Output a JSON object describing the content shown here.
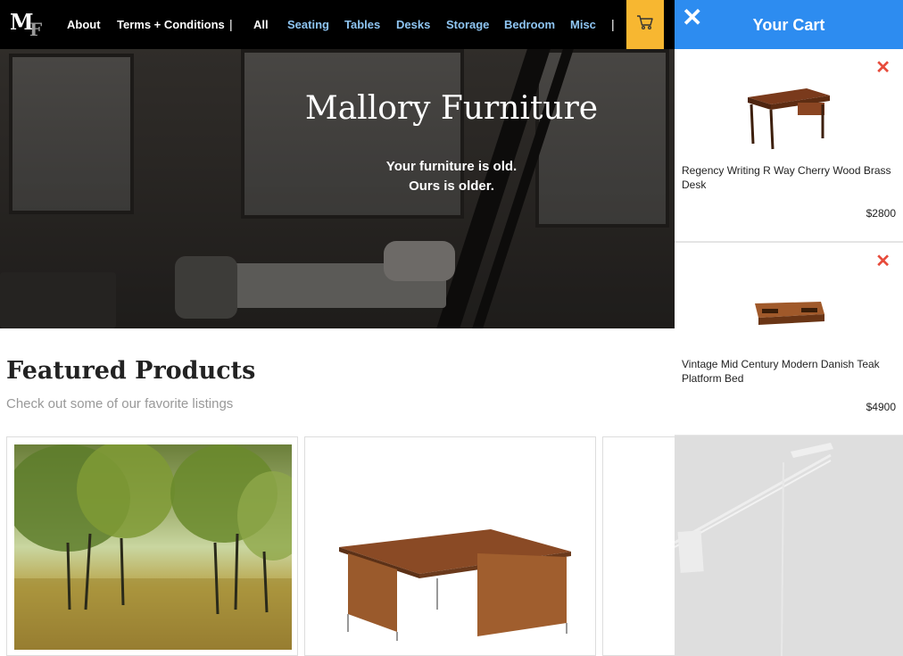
{
  "nav": {
    "about": "About",
    "terms": "Terms + Conditions",
    "separator": "|",
    "categories": [
      "All",
      "Seating",
      "Tables",
      "Desks",
      "Storage",
      "Bedroom",
      "Misc"
    ]
  },
  "hero": {
    "title": "Mallory Furniture",
    "subtitle_line1": "Your furniture is old.",
    "subtitle_line2": "Ours is older."
  },
  "featured": {
    "title": "Featured Products",
    "subtitle": "Check out some of our favorite listings"
  },
  "cart": {
    "title": "Your Cart",
    "close": "✕",
    "remove": "✕",
    "items": [
      {
        "name": "Regency Writing R Way Cherry Wood Brass Desk",
        "price": "$2800"
      },
      {
        "name": "Vintage Mid Century Modern Danish Teak Platform Bed",
        "price": "$4900"
      }
    ]
  },
  "colors": {
    "nav_bg": "#000000",
    "category_link": "#8ec5f2",
    "cart_button": "#f7b731",
    "cart_header": "#2d8cf0",
    "remove_x": "#e74c3c"
  }
}
